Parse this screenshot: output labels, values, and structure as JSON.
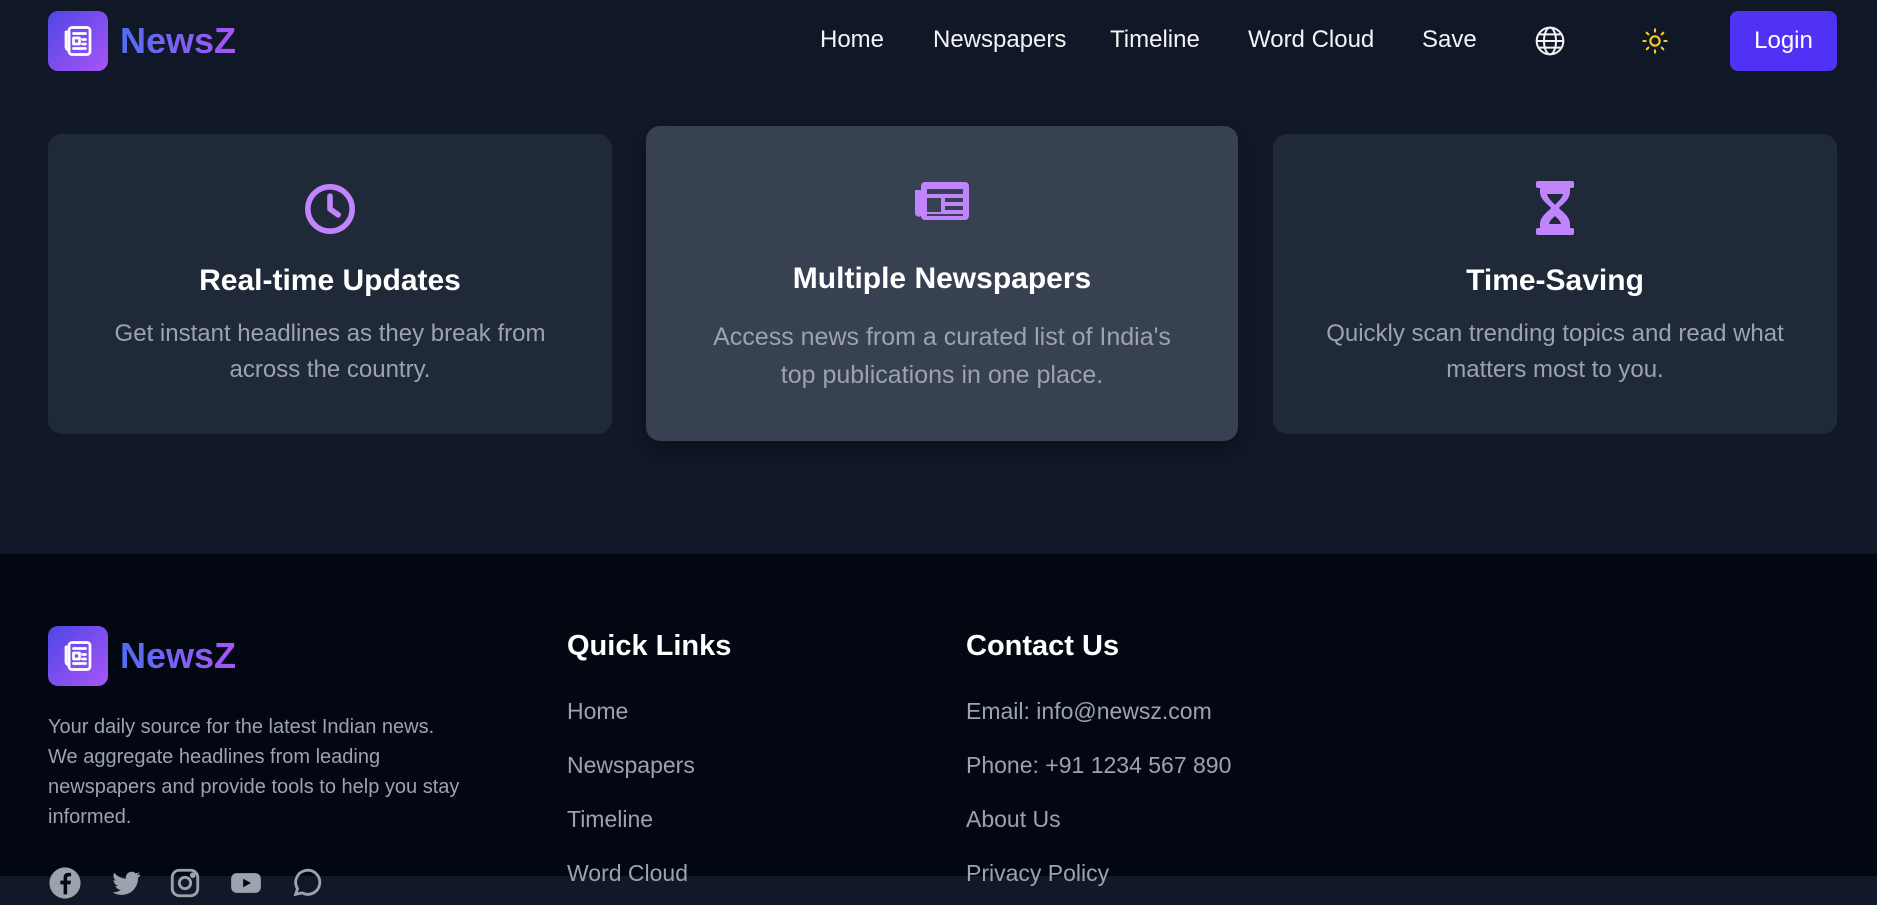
{
  "brand": {
    "name": "NewsZ"
  },
  "nav": {
    "links": [
      "Home",
      "Newspapers",
      "Timeline",
      "Word Cloud",
      "Save"
    ],
    "language_icon": "globe-icon",
    "theme_icon": "sun-icon",
    "login_label": "Login"
  },
  "features": [
    {
      "icon": "clock-icon",
      "title": "Real-time Updates",
      "desc": "Get instant headlines as they break from across the country."
    },
    {
      "icon": "newspaper-icon",
      "title": "Multiple Newspapers",
      "desc": "Access news from a curated list of India's top publications in one place."
    },
    {
      "icon": "hourglass-icon",
      "title": "Time-Saving",
      "desc": "Quickly scan trending topics and read what matters most to you."
    }
  ],
  "footer": {
    "tagline": "Your daily source for the latest Indian news. We aggregate headlines from leading newspapers and provide tools to help you stay informed.",
    "quick_links_title": "Quick Links",
    "quick_links": [
      "Home",
      "Newspapers",
      "Timeline",
      "Word Cloud"
    ],
    "contact_title": "Contact Us",
    "contact_items": [
      "Email: info@newsz.com",
      "Phone: +91 1234 567 890",
      "About Us",
      "Privacy Policy"
    ],
    "social_icons": [
      "facebook-icon",
      "twitter-icon",
      "instagram-icon",
      "youtube-icon",
      "whatsapp-icon"
    ]
  },
  "colors": {
    "accent": "#4f32f5",
    "icon_purple": "#c084fc",
    "sun_yellow": "#facc15"
  }
}
